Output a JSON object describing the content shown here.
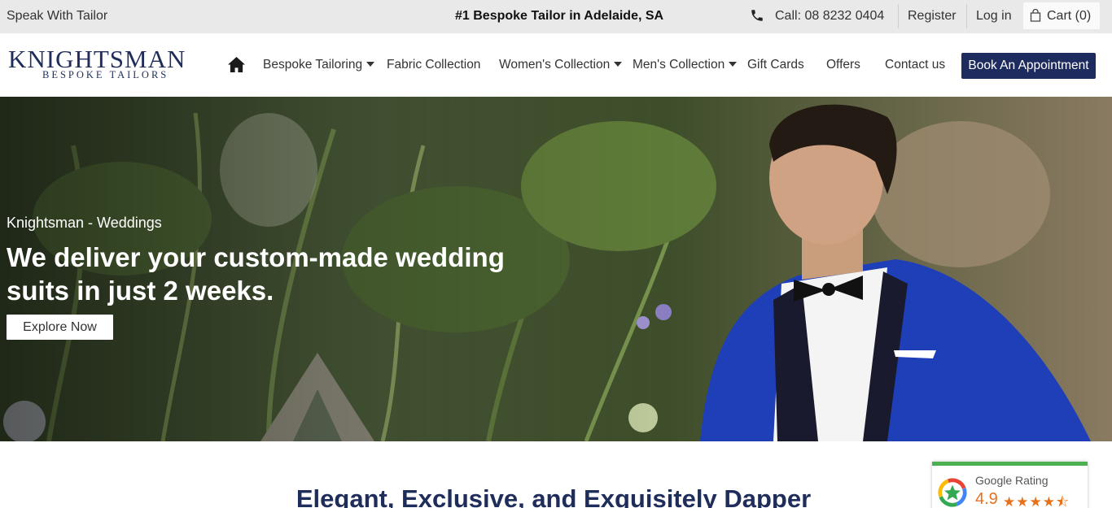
{
  "topbar": {
    "speak": "Speak With Tailor",
    "tagline": "#1 Bespoke Tailor in Adelaide, SA",
    "phone": "Call: 08 8232 0404",
    "register": "Register",
    "login": "Log in",
    "cart": "Cart (0)"
  },
  "logo": {
    "brand": "KNIGHTSMAN",
    "sub": "BESPOKE TAILORS"
  },
  "nav": {
    "items": [
      {
        "label": "Bespoke Tailoring",
        "dropdown": true
      },
      {
        "label": "Fabric Collection",
        "dropdown": false
      },
      {
        "label": "Women's Collection",
        "dropdown": true
      },
      {
        "label": "Men's Collection",
        "dropdown": true
      },
      {
        "label": "Gift Cards",
        "dropdown": false
      },
      {
        "label": "Offers",
        "dropdown": false
      },
      {
        "label": "Contact us",
        "dropdown": false
      }
    ],
    "cta": "Book An Appointment"
  },
  "hero": {
    "eyebrow": "Knightsman - Weddings",
    "headline": "We deliver your custom-made wedding suits in just 2 weeks.",
    "button": "Explore Now"
  },
  "section": {
    "title": "Elegant, Exclusive, and Exquisitely Dapper"
  },
  "rating": {
    "label": "Google Rating",
    "score": "4.9",
    "stars": "★★★★⯪",
    "stars_value": 4.9
  },
  "colors": {
    "brand_navy": "#1e2b5e",
    "topbar_bg": "#e9e9ea",
    "rating_accent": "#4caf50",
    "star_orange": "#e7711b"
  },
  "icons": [
    "phone-icon",
    "cart-icon",
    "home-icon",
    "caret-down-icon",
    "google-icon"
  ]
}
